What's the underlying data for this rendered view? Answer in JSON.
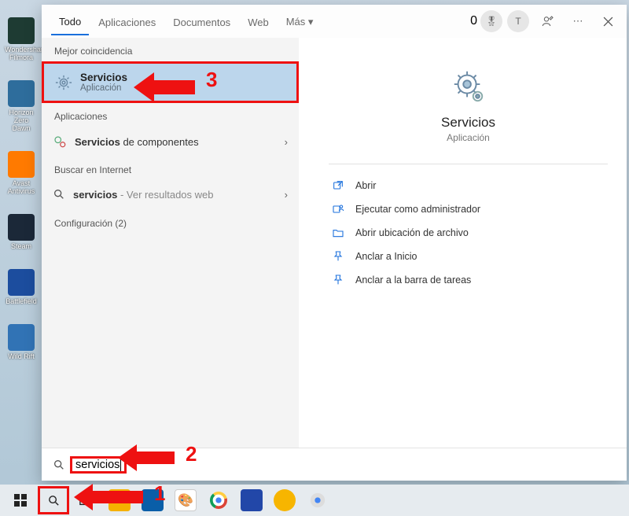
{
  "desktop": {
    "icons": [
      {
        "label": "Wondershare Filmora",
        "bg": "#1e3b33"
      },
      {
        "label": "Horizon Zero Dawn",
        "bg": "#2e6d9c"
      },
      {
        "label": "Avast Antivirus",
        "bg": "#ff7a00"
      },
      {
        "label": "Steam",
        "bg": "#1b2838"
      },
      {
        "label": "Battlefield",
        "bg": "#1c4d9e"
      },
      {
        "label": "Wild Rift",
        "bg": "#3173b5"
      }
    ]
  },
  "tabs": {
    "items": [
      {
        "label": "Todo"
      },
      {
        "label": "Aplicaciones"
      },
      {
        "label": "Documentos"
      },
      {
        "label": "Web"
      },
      {
        "label": "Más  ▾"
      }
    ],
    "active": 0,
    "rewards_count": "0",
    "avatar_letter": "T"
  },
  "left": {
    "best_label": "Mejor coincidencia",
    "best": {
      "title": "Servicios",
      "subtitle": "Aplicación"
    },
    "apps_label": "Aplicaciones",
    "apps_item_bold": "Servicios",
    "apps_item_rest": " de componentes",
    "web_label": "Buscar en Internet",
    "web_item_bold": "servicios",
    "web_item_rest": " - Ver resultados web",
    "config_label": "Configuración (2)"
  },
  "details": {
    "title": "Servicios",
    "subtitle": "Aplicación",
    "actions": [
      {
        "label": "Abrir",
        "icon": "open"
      },
      {
        "label": "Ejecutar como administrador",
        "icon": "admin"
      },
      {
        "label": "Abrir ubicación de archivo",
        "icon": "folder"
      },
      {
        "label": "Anclar a Inicio",
        "icon": "pin"
      },
      {
        "label": "Anclar a la barra de tareas",
        "icon": "pin"
      }
    ]
  },
  "search": {
    "value": "servicios"
  },
  "annotations": {
    "n1": "1",
    "n2": "2",
    "n3": "3"
  }
}
